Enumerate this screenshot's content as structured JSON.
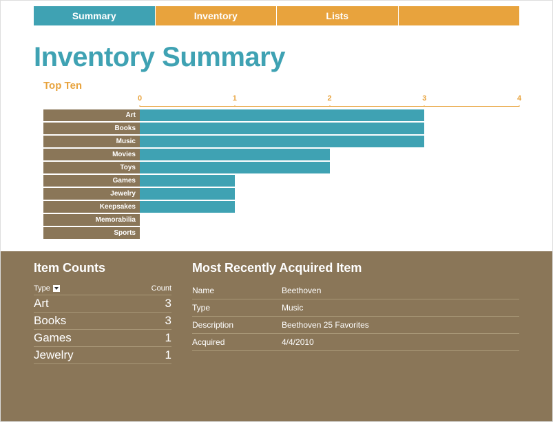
{
  "tabs": [
    {
      "label": "Summary",
      "active": true
    },
    {
      "label": "Inventory",
      "active": false
    },
    {
      "label": "Lists",
      "active": false
    },
    {
      "label": "",
      "active": false
    }
  ],
  "page_title": "Inventory Summary",
  "subtitle": "Top Ten",
  "chart_data": {
    "type": "bar",
    "orientation": "horizontal",
    "title": "Top Ten",
    "xlabel": "",
    "ylabel": "",
    "xlim": [
      0,
      4
    ],
    "ticks": [
      0,
      1,
      2,
      3,
      4
    ],
    "categories": [
      "Art",
      "Books",
      "Music",
      "Movies",
      "Toys",
      "Games",
      "Jewelry",
      "Keepsakes",
      "Memorabilia",
      "Sports"
    ],
    "values": [
      3,
      3,
      3,
      2,
      2,
      1,
      1,
      1,
      0,
      0
    ],
    "bar_color": "#3fa2b3",
    "label_bg": "#8a7658"
  },
  "item_counts": {
    "title": "Item Counts",
    "header_type": "Type",
    "header_count": "Count",
    "rows": [
      {
        "type": "Art",
        "count": 3
      },
      {
        "type": "Books",
        "count": 3
      },
      {
        "type": "Games",
        "count": 1
      },
      {
        "type": "Jewelry",
        "count": 1
      }
    ]
  },
  "recent_item": {
    "title": "Most Recently Acquired Item",
    "fields": [
      {
        "label": "Name",
        "value": "Beethoven"
      },
      {
        "label": "Type",
        "value": "Music"
      },
      {
        "label": "Description",
        "value": "Beethoven 25 Favorites"
      },
      {
        "label": "Acquired",
        "value": "4/4/2010"
      }
    ]
  }
}
